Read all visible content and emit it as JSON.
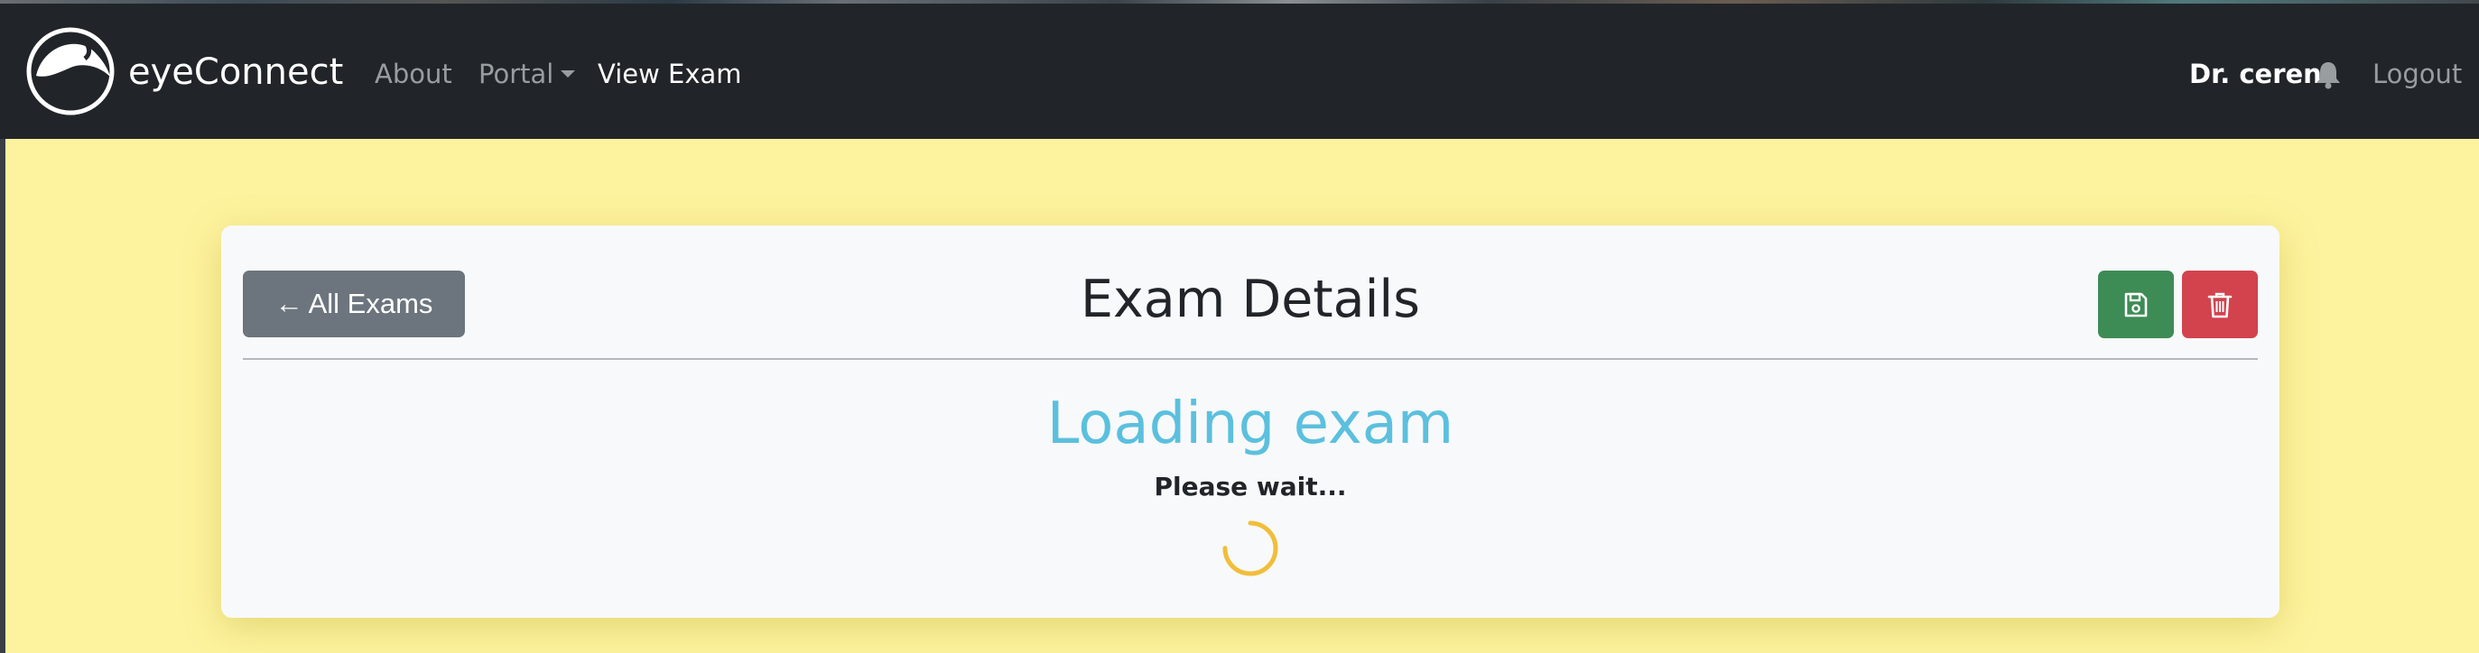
{
  "navbar": {
    "brand": "eyeConnect",
    "links": {
      "about": "About",
      "portal": "Portal",
      "view_exam": "View Exam"
    },
    "user": "Dr. ceren",
    "logout": "Logout"
  },
  "card": {
    "back_button": "All Exams",
    "back_arrow": "←",
    "title": "Exam Details"
  },
  "loading": {
    "title": "Loading exam",
    "message": "Please wait..."
  },
  "colors": {
    "page_background": "#fdf39e",
    "navbar": "#212529",
    "save": "#3d8b55",
    "delete": "#d2434e",
    "loading_text": "#5bc0de",
    "spinner": "#f0be3a"
  },
  "icons": {
    "brand": "eye-logo-icon",
    "notifications": "bell-icon",
    "save": "floppy-disk-icon",
    "delete": "trash-icon",
    "loading": "spinner-icon"
  }
}
